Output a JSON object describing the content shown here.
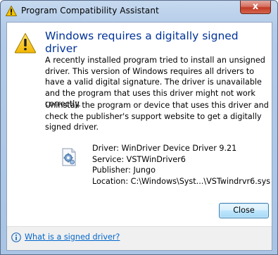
{
  "window": {
    "title": "Program Compatibility Assistant",
    "close_glyph": "x"
  },
  "dialog": {
    "heading": "Windows requires a digitally signed driver",
    "paragraph1": "A recently installed program tried to install an unsigned driver. This version of Windows requires all drivers to have a valid digital signature. The driver is unavailable and the program that uses this driver might not work correctly.",
    "paragraph2": "Uninstall the program or device that uses this driver and check the publisher's support website to get a digitally signed driver."
  },
  "driver": {
    "driver": "Driver: WinDriver Device Driver 9.21",
    "service": "Service: VSTWinDriver6",
    "publisher": "Publisher: Jungo",
    "location": "Location: C:\\Windows\\Syst...\\VSTwindrvr6.sys"
  },
  "buttons": {
    "close_label": "Close"
  },
  "footer": {
    "link_label": "What is a signed driver?"
  },
  "icons": {
    "title": "compatibility-assistant-icon",
    "warning": "warning-icon",
    "driver": "driver-gear-icon",
    "info": "info-icon"
  },
  "colors": {
    "heading": "#003399",
    "link": "#0066cc",
    "close_button_red": "#c23a25"
  }
}
